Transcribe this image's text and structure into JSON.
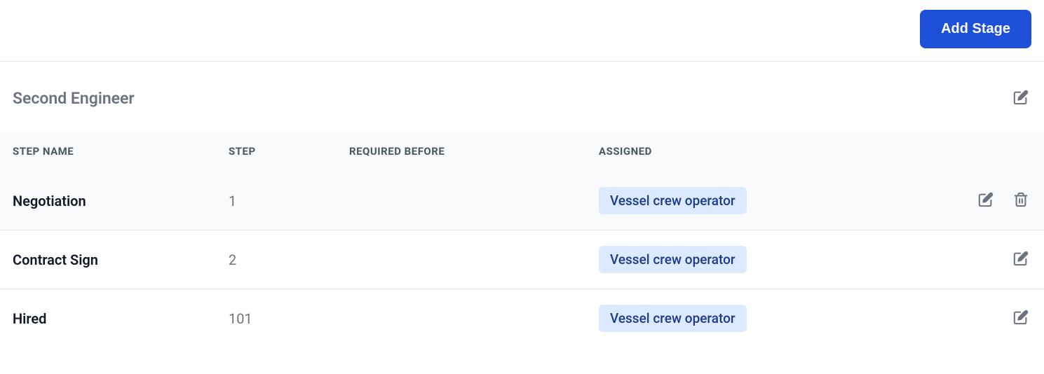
{
  "header": {
    "add_stage_label": "Add Stage"
  },
  "section": {
    "title": "Second Engineer"
  },
  "table": {
    "columns": {
      "step_name": "STEP NAME",
      "step": "STEP",
      "required_before": "REQUIRED BEFORE",
      "assigned": "ASSIGNED"
    },
    "rows": [
      {
        "step_name": "Negotiation",
        "step": "1",
        "required_before": "",
        "assigned": "Vessel crew operator",
        "deletable": true
      },
      {
        "step_name": "Contract Sign",
        "step": "2",
        "required_before": "",
        "assigned": "Vessel crew operator",
        "deletable": false
      },
      {
        "step_name": "Hired",
        "step": "101",
        "required_before": "",
        "assigned": "Vessel crew operator",
        "deletable": false
      }
    ]
  }
}
